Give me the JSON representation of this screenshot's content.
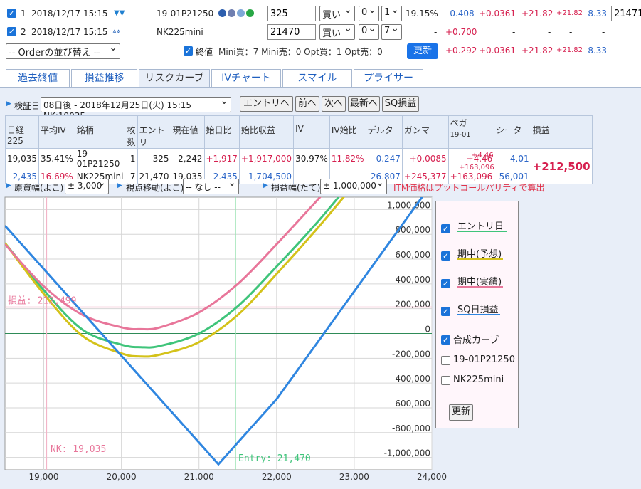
{
  "positions": [
    {
      "index": "1",
      "datetime": "2018/12/17 15:15",
      "name": "19-01P21250",
      "price_value": "325",
      "side": "買い",
      "qty_a": "0",
      "qty_b": "1",
      "iv": "19.15%",
      "delta": "-0.408",
      "gamma": "+0.0361",
      "vega": "+21.82",
      "vega_small": "+21.82",
      "theta": "-8.33",
      "extra_value": "21471"
    },
    {
      "index": "2",
      "datetime": "2018/12/17 15:15",
      "name": "NK225mini",
      "price_value": "21470",
      "side": "買い",
      "qty_a": "0",
      "qty_b": "7",
      "iv": "-",
      "delta": "+0.700",
      "gamma": "-",
      "vega": "-",
      "vega_small": "-",
      "theta": "-"
    }
  ],
  "order_select": "-- Orderの並び替え --",
  "summary": {
    "close_label": "終値",
    "text": "Mini買：7 Mini売：0 Opt買：1 Opt売：0",
    "update_label": "更新",
    "delta": "+0.292",
    "gamma": "+0.0361",
    "vega": "+21.82",
    "vega_small": "+21.82",
    "theta": "-8.33"
  },
  "tabs": [
    "過去終値",
    "損益推移",
    "リスクカーブ",
    "IVチャート",
    "スマイル",
    "プライサー"
  ],
  "verify": {
    "label": "検証日",
    "select": "08日後 - 2018年12月25日(火) 15:15 NK:19035",
    "buttons": [
      "エントリへ",
      "前へ",
      "次へ",
      "最新へ",
      "SQ損益"
    ]
  },
  "table": {
    "headers": [
      "日経225",
      "平均IV",
      "銘柄",
      "枚数",
      "エントリ",
      "現在値",
      "始日比",
      "始比収益",
      "IV",
      "IV始比",
      "デルタ",
      "ガンマ",
      "ベガ",
      "シータ",
      "損益"
    ],
    "vega_sub": "19-01",
    "nk_value": "19,035",
    "nk_change": "-2,435",
    "avg_iv": "35.41%",
    "avg_iv2": "16.69%",
    "rows": [
      {
        "name": "19-01P21250",
        "qty": "1",
        "entry": "325",
        "current": "2,242",
        "change": "+1,917",
        "profit": "+1,917,000",
        "iv": "30.97%",
        "iv_change": "11.82%",
        "delta": "-0.247",
        "gamma": "+0.0085",
        "vega": "+4.46",
        "theta": "-4.01"
      },
      {
        "name": "NK225mini",
        "qty": "7",
        "entry": "21,470",
        "current": "19,035",
        "change": "-2,435",
        "profit": "-1,704,500",
        "delta": "-26,807",
        "gamma": "+245,377",
        "vega": "+163,096",
        "theta": "-56,001"
      }
    ],
    "vega_mid": "+4.46",
    "vega_mid2": "+163,096",
    "total_pl": "+212,500"
  },
  "controls": {
    "price_width_label": "原資幅(よこ)",
    "price_width_value": "± 3,000",
    "view_label": "視点移動(よこ)",
    "view_value": "-- なし --",
    "pl_width_label": "損益幅(たて)",
    "pl_width_value": "± 1,000,000",
    "note": "ITM価格はプットコールパリティで算出"
  },
  "legend": {
    "items": [
      {
        "label": "エントリ日",
        "checked": true,
        "color": "#3fc47a"
      },
      {
        "label": "期中(予想)",
        "checked": true,
        "color": "#d4c21a"
      },
      {
        "label": "期中(実績)",
        "checked": true,
        "color": "#e8769a"
      },
      {
        "label": "SQ日損益",
        "checked": true,
        "color": "#2f86e0"
      },
      {
        "label": "合成カーブ",
        "checked": true,
        "color": ""
      },
      {
        "label": "19-01P21250",
        "checked": false,
        "color": ""
      },
      {
        "label": "NK225mini",
        "checked": false,
        "color": ""
      }
    ],
    "update_label": "更新"
  },
  "chart_data": {
    "type": "line",
    "xlim": [
      18500,
      24000
    ],
    "ylim": [
      -1100000,
      1100000
    ],
    "x_ticks": [
      "19,000",
      "20,000",
      "21,000",
      "22,000",
      "23,000",
      "24,000"
    ],
    "y_ticks": [
      "1,000,000",
      "800,000",
      "600,000",
      "400,000",
      "200,000",
      "0",
      "-200,000",
      "-400,000",
      "-600,000",
      "-800,000",
      "-1,000,000"
    ],
    "annotations": {
      "pl_label": "損益: 212,499",
      "pl_value": 212499,
      "nk_label": "NK: 19,035",
      "nk_value": 19035,
      "entry_label": "Entry: 21,470",
      "entry_value": 21470
    },
    "series": [
      {
        "name": "エントリ日",
        "color": "#3fc47a",
        "x": [
          18500,
          19000,
          19500,
          20000,
          20250,
          20500,
          21000,
          21500,
          22000,
          22500,
          23000,
          23500,
          24000
        ],
        "y": [
          730000,
          350000,
          30000,
          -90000,
          -110000,
          -100000,
          0,
          220000,
          540000,
          880000,
          1250000,
          1600000,
          1950000
        ]
      },
      {
        "name": "期中(予想)",
        "color": "#d4c21a",
        "x": [
          18500,
          19000,
          19500,
          20000,
          20250,
          20500,
          21000,
          21500,
          22000,
          22500,
          23000,
          23500,
          24000
        ],
        "y": [
          730000,
          320000,
          -20000,
          -160000,
          -185000,
          -170000,
          -70000,
          150000,
          480000,
          830000,
          1200000,
          1550000,
          1900000
        ]
      },
      {
        "name": "期中(実績)",
        "color": "#e8769a",
        "x": [
          18500,
          19000,
          19500,
          20000,
          20250,
          20500,
          21000,
          21500,
          22000,
          22500,
          23000,
          23500,
          24000
        ],
        "y": [
          720000,
          380000,
          150000,
          50000,
          35000,
          50000,
          170000,
          400000,
          720000,
          1060000,
          1400000,
          1750000,
          2100000
        ]
      },
      {
        "name": "SQ日損益",
        "color": "#2f86e0",
        "x": [
          18500,
          21250,
          22000,
          24000
        ],
        "y": [
          870000,
          -1055000,
          -530000,
          1210000
        ]
      }
    ]
  }
}
